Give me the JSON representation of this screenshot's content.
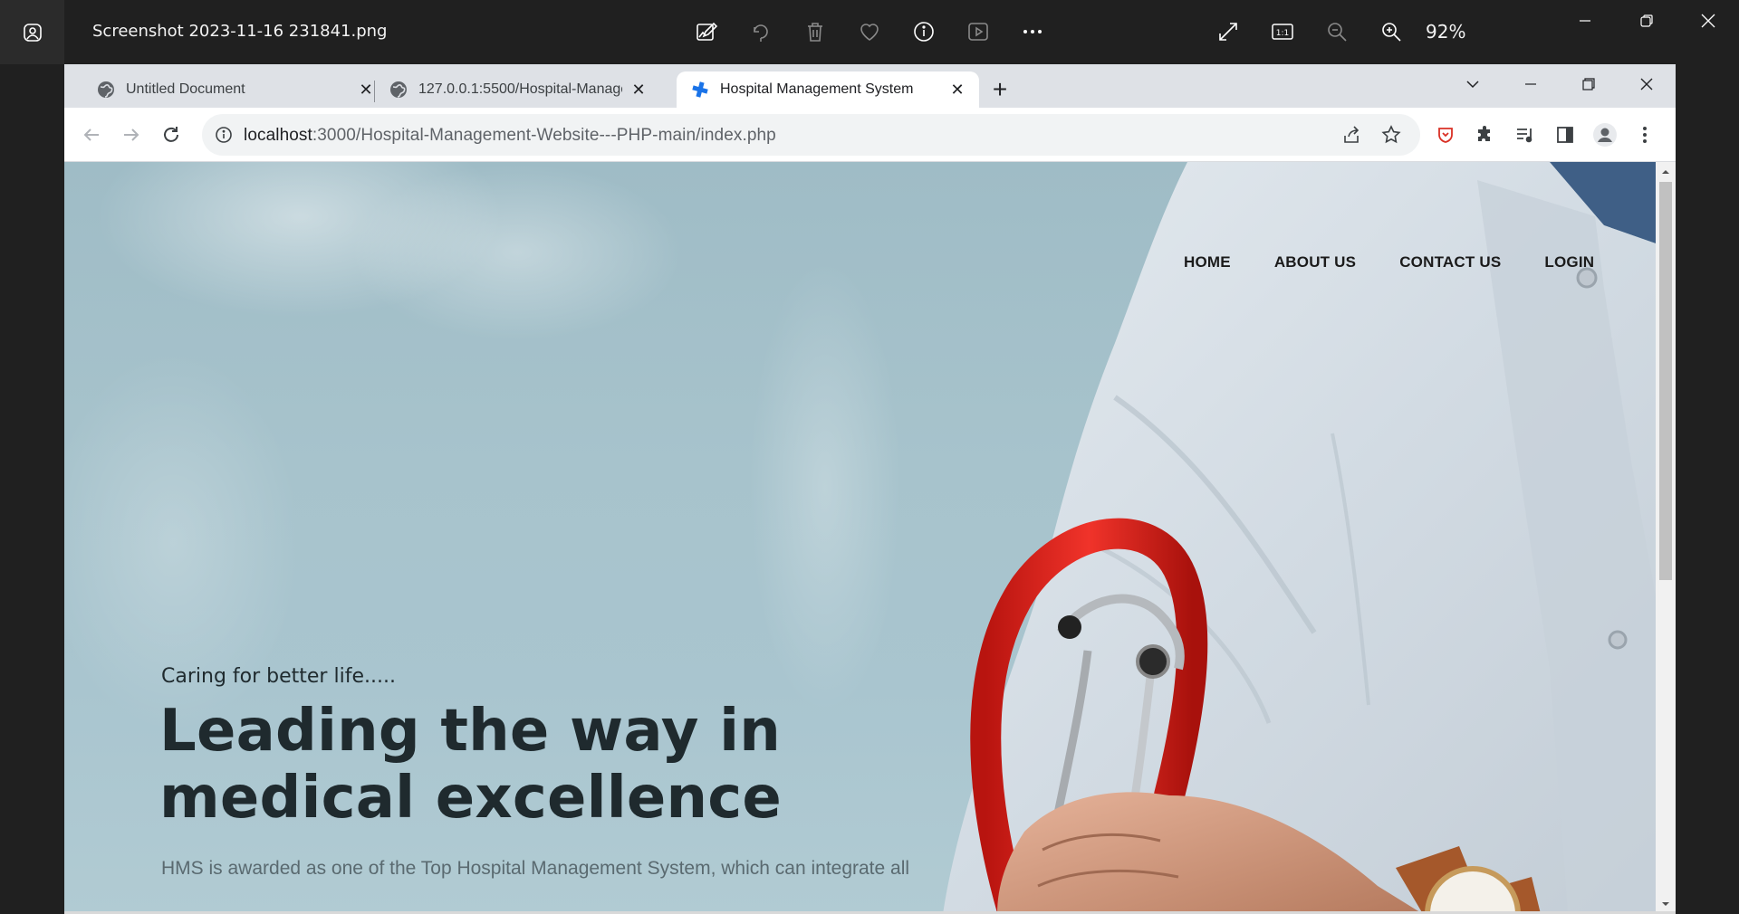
{
  "viewer": {
    "file_title": "Screenshot 2023-11-16 231841.png",
    "zoom": "92%",
    "tools": [
      "edit-icon",
      "rotate-icon",
      "delete-icon",
      "favorite-icon",
      "info-icon",
      "slideshow-icon",
      "more-icon"
    ],
    "right_tools": [
      "fullscreen-icon",
      "actual-size-icon",
      "zoom-out-icon",
      "zoom-in-icon"
    ]
  },
  "browser": {
    "tabs": [
      {
        "label": "Untitled Document",
        "icon": "globe-icon"
      },
      {
        "label": "127.0.0.1:5500/Hospital-Manage",
        "icon": "globe-icon"
      },
      {
        "label": "Hospital Management System",
        "icon": "medical-cross-icon",
        "active": true
      }
    ],
    "url_host": "localhost",
    "url_rest": ":3000/Hospital-Management-Website---PHP-main/index.php"
  },
  "site": {
    "nav": [
      "HOME",
      "ABOUT US",
      "CONTACT US",
      "LOGIN"
    ],
    "kicker": "Caring for better life.....",
    "title": "Leading the way in medical excellence",
    "description": "HMS is awarded as one of the Top Hospital Management System, which can integrate all"
  },
  "colors": {
    "accent_tab_icon": "#1a73e8",
    "stethoscope": "#e0251b",
    "hero_text": "#1f2a2e"
  }
}
